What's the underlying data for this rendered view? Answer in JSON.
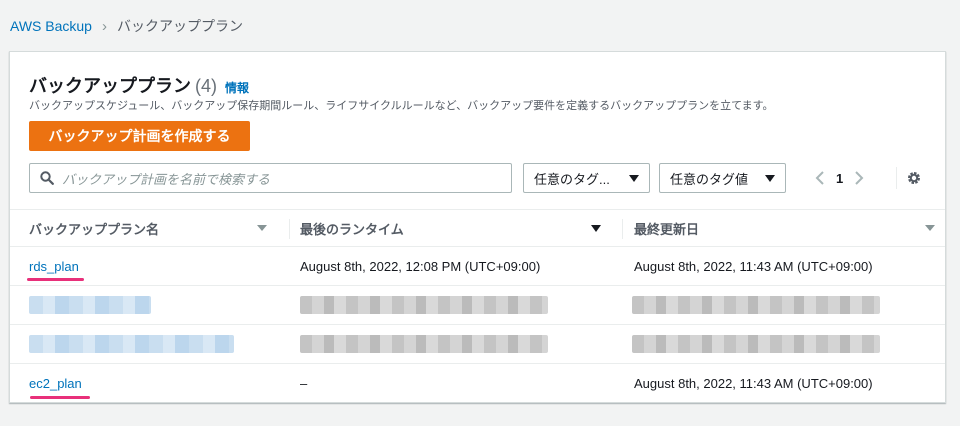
{
  "breadcrumb": {
    "root": "AWS Backup",
    "current": "バックアッププラン"
  },
  "header": {
    "title": "バックアッププラン",
    "count": "(4)",
    "info": "情報",
    "description": "バックアップスケジュール、バックアップ保存期間ルール、ライフサイクルルールなど、バックアップ要件を定義するバックアッププランを立てます。"
  },
  "toolbar": {
    "create_label": "バックアップ計画を作成する",
    "search_placeholder": "バックアップ計画を名前で検索する",
    "tag_key_select": "任意のタグ...",
    "tag_value_select": "任意のタグ値",
    "page": "1"
  },
  "table": {
    "columns": [
      "バックアッププラン名",
      "最後のランタイム",
      "最終更新日"
    ],
    "rows": [
      {
        "name": "rds_plan",
        "last_run": "August 8th, 2022, 12:08 PM (UTC+09:00)",
        "updated": "August 8th, 2022, 11:43 AM (UTC+09:00)"
      },
      {
        "name": "",
        "last_run": "",
        "updated": ""
      },
      {
        "name": "",
        "last_run": "",
        "updated": ""
      },
      {
        "name": "ec2_plan",
        "last_run": "–",
        "updated": "August 8th, 2022, 11:43 AM (UTC+09:00)"
      }
    ]
  },
  "colors": {
    "accent": "#ec7211",
    "link": "#0073bb",
    "highlight": "#e8307a"
  }
}
